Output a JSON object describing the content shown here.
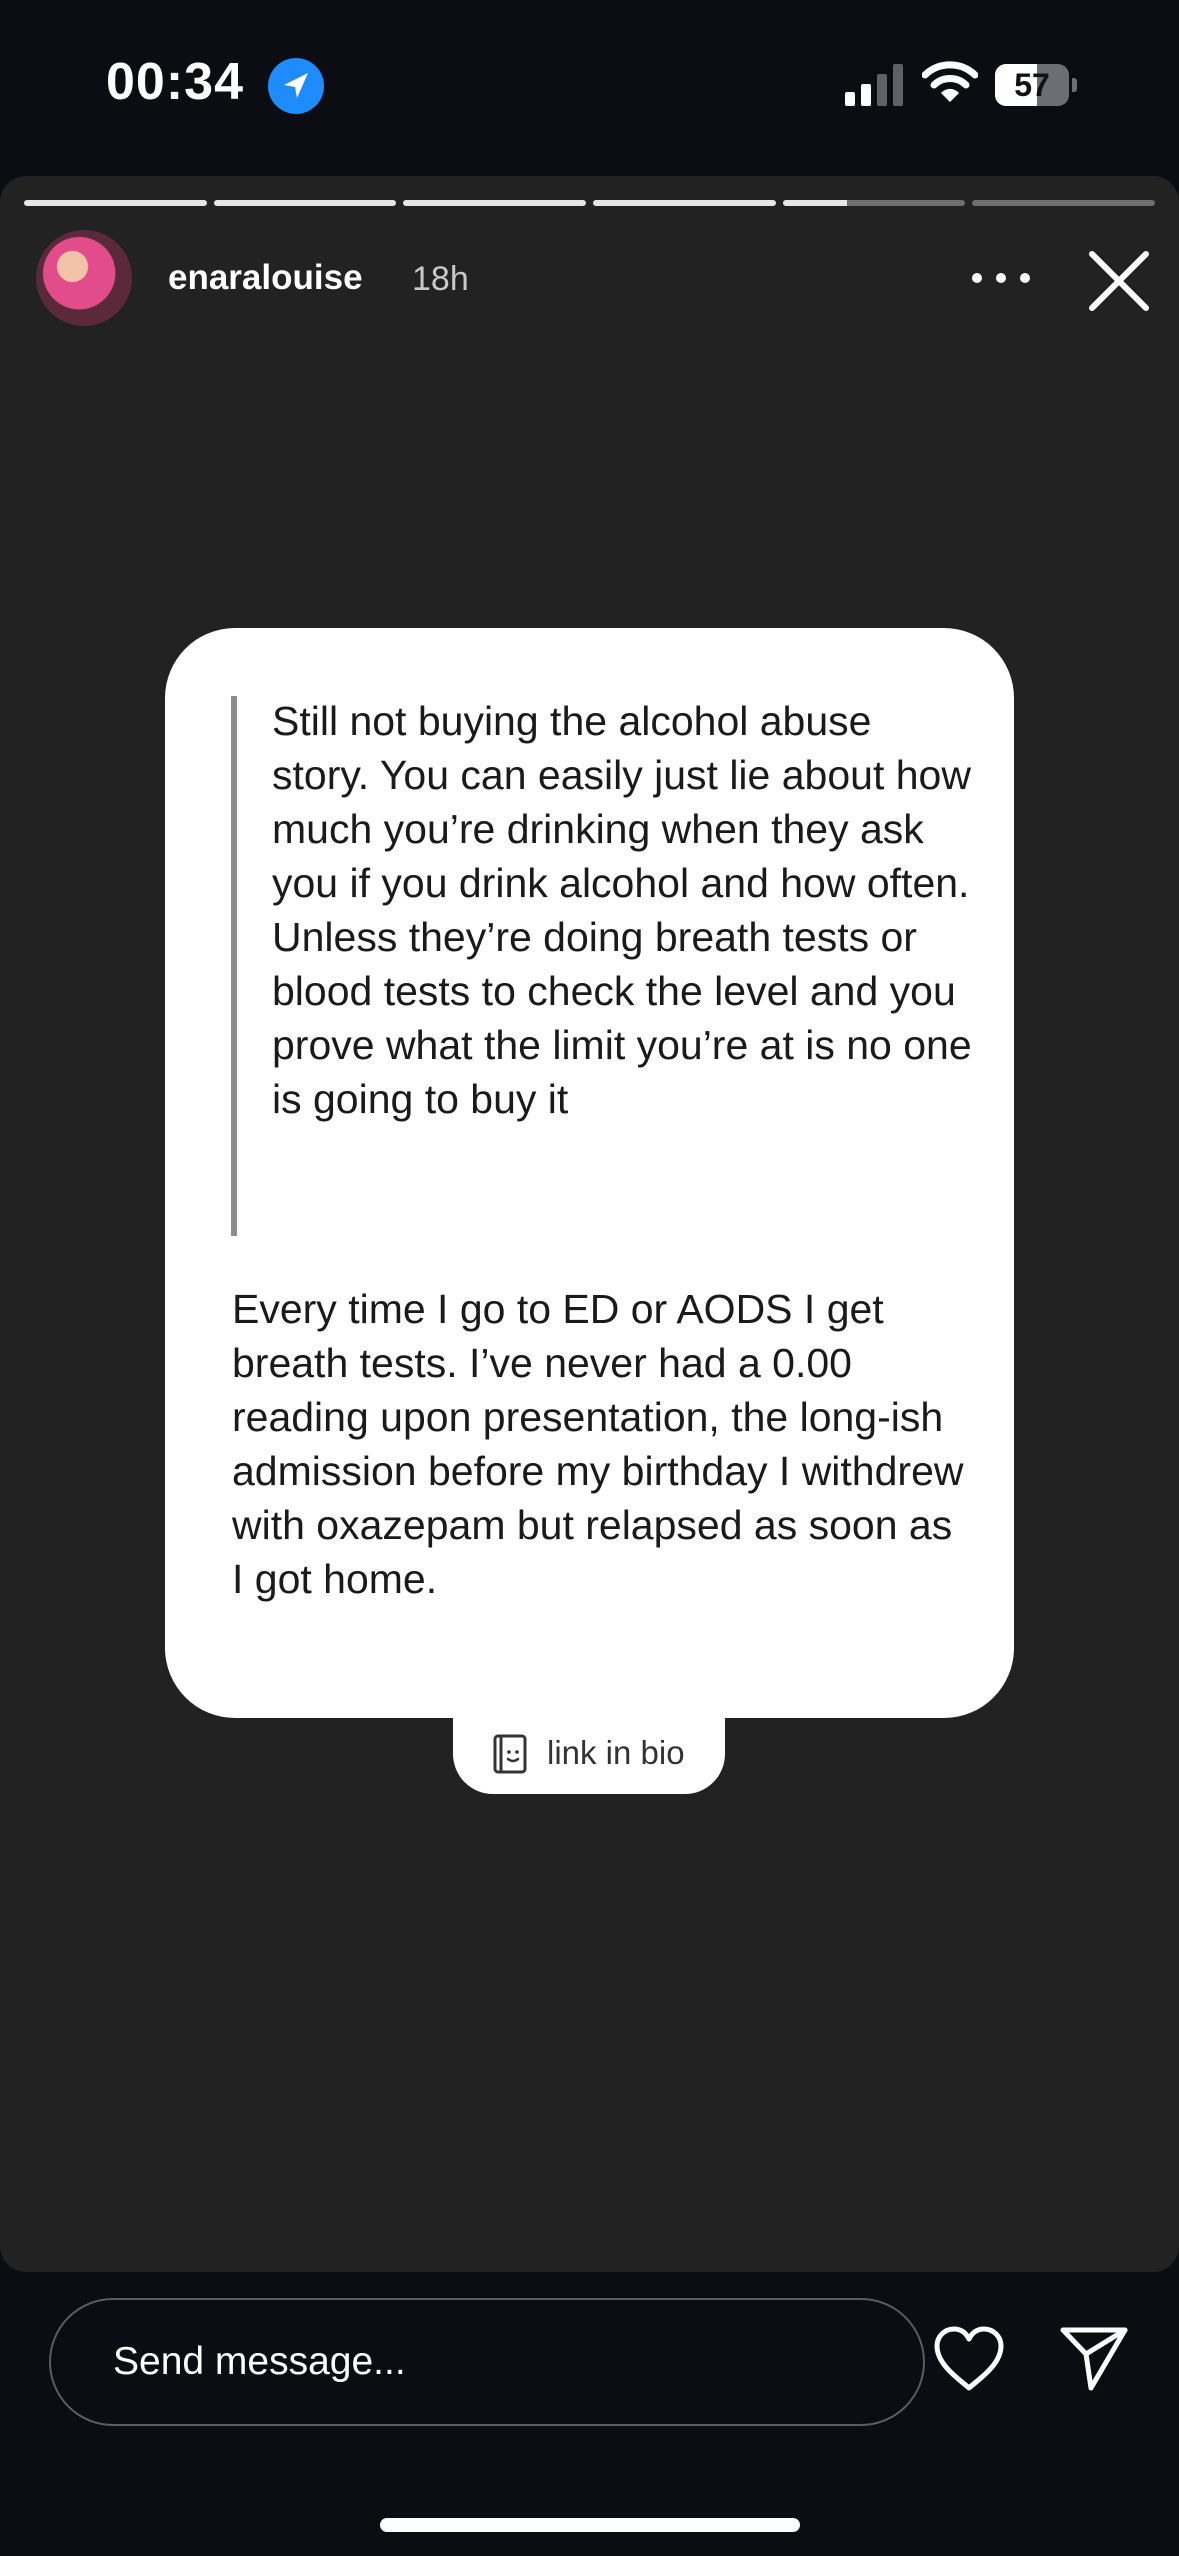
{
  "status_bar": {
    "time": "00:34",
    "battery_level": "57",
    "battery_fraction": 0.57,
    "icons": [
      "location-arrow-icon",
      "cellular-signal-icon",
      "wifi-icon",
      "battery-icon"
    ]
  },
  "story": {
    "segments": [
      1,
      1,
      1,
      1,
      0.35,
      0
    ],
    "username": "enaralouise",
    "time_ago": "18h",
    "header_icons": [
      "more-icon",
      "close-icon"
    ]
  },
  "card": {
    "quote": "Still not buying the alcohol abuse story. You can easily just lie about how much you’re drinking when they ask you if you drink alcohol and how often. Unless they’re doing breath tests or blood tests to check the level and you prove what the limit you’re at is no one is going to buy it",
    "reply": "Every time I go to ED or AODS I get breath tests. I’ve never had a 0.00 reading upon presentation, the long-ish admission before my birthday I withdrew with oxazepam but relapsed as soon as I got home.",
    "link_label": "link in bio"
  },
  "bottom": {
    "placeholder": "Send message...",
    "icons": [
      "heart-icon",
      "send-icon"
    ]
  },
  "colors": {
    "page_background": "#0b0d12",
    "story_background": "#222222",
    "location_blue": "#1e8bff"
  }
}
